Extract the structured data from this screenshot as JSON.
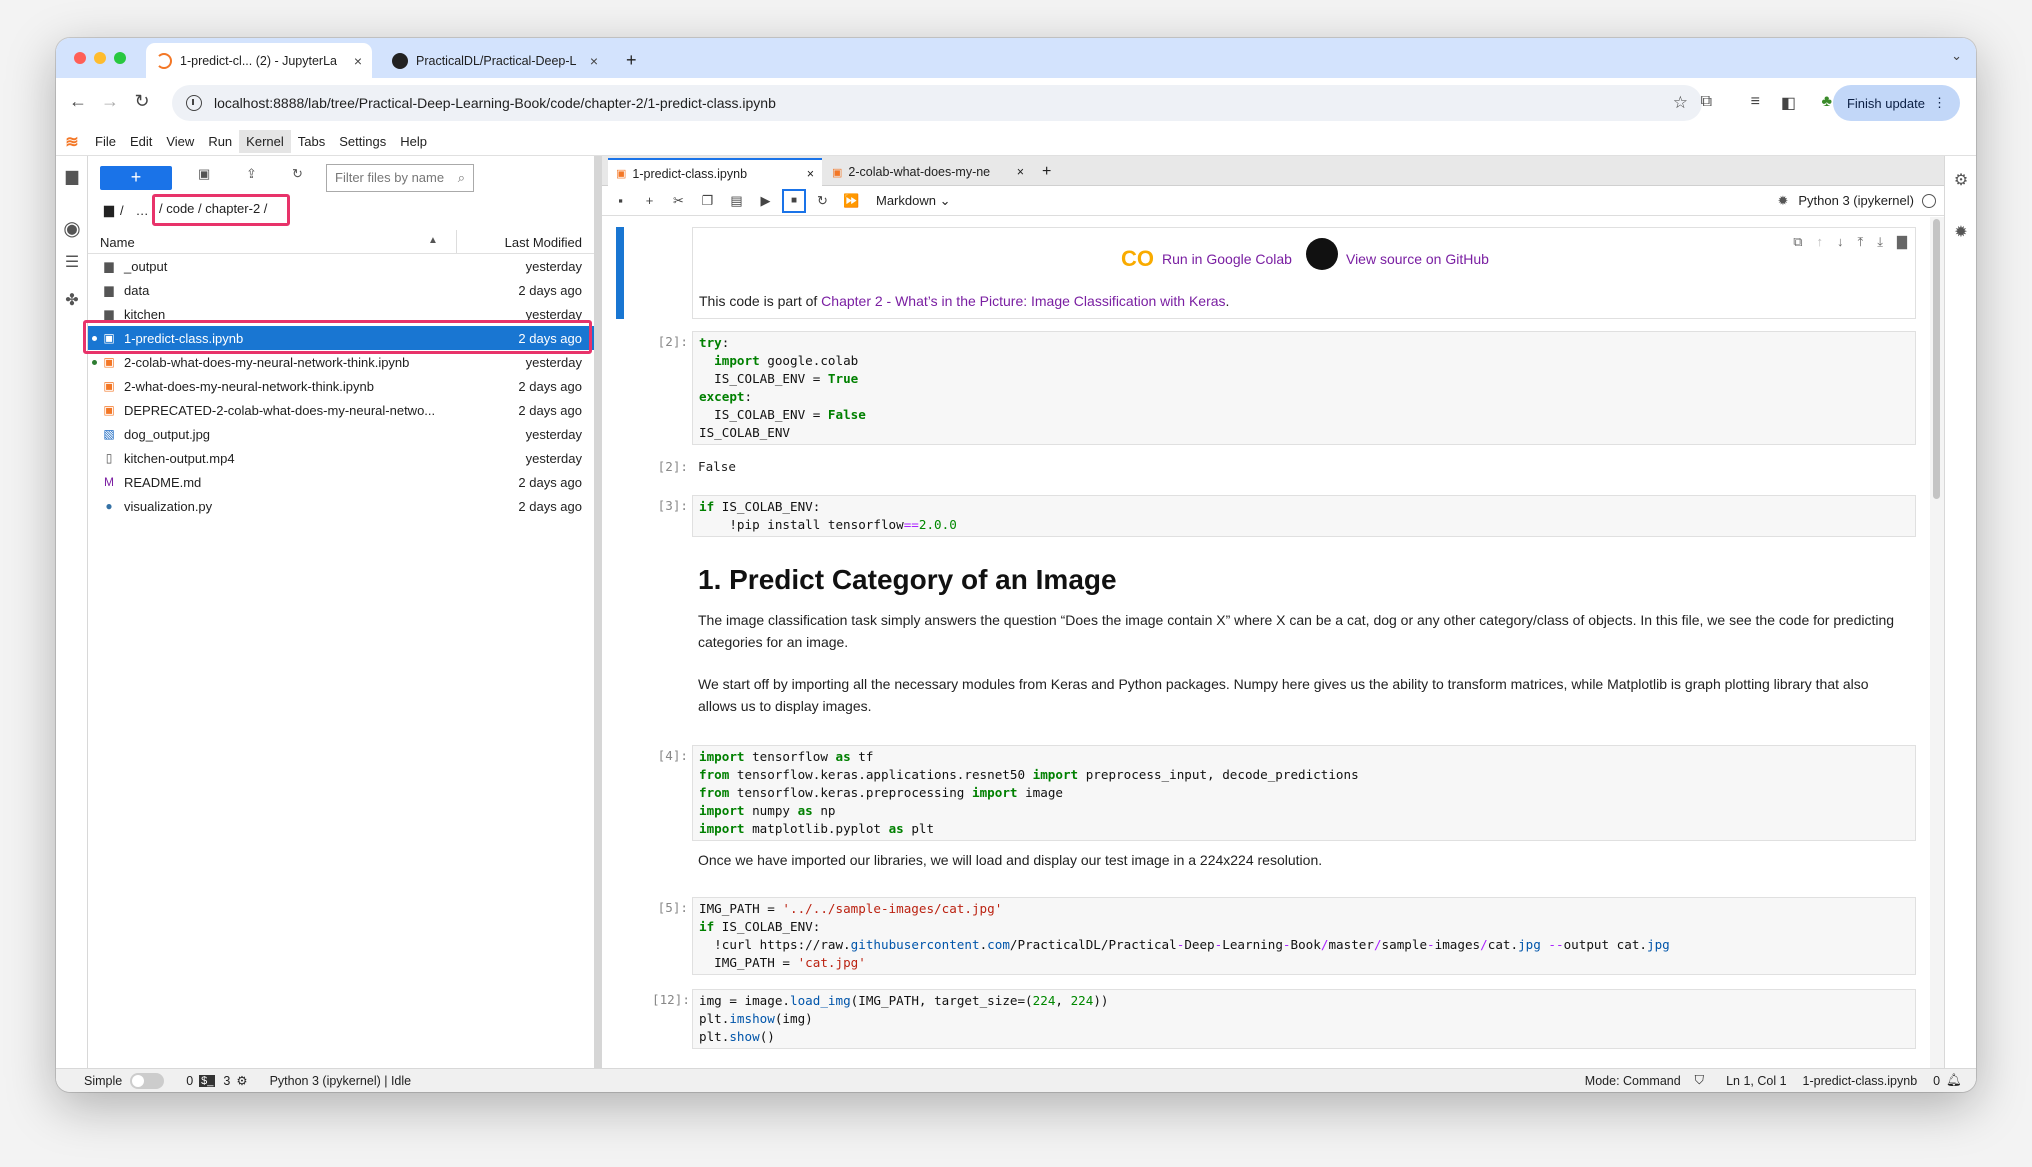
{
  "browser": {
    "tabs": [
      {
        "title": "1-predict-cl... (2) - JupyterLa",
        "close": "×"
      },
      {
        "title": "PracticalDL/Practical-Deep-L",
        "close": "×"
      }
    ],
    "new_tab": "+",
    "url": "localhost:8888/lab/tree/Practical-Deep-Learning-Book/code/chapter-2/1-predict-class.ipynb",
    "finish_update": "Finish update",
    "colors": {
      "close": "#ff5f57",
      "min": "#febc2e",
      "max": "#28c840"
    }
  },
  "menu": {
    "logo": "≋",
    "items": [
      "File",
      "Edit",
      "View",
      "Run",
      "Kernel",
      "Tabs",
      "Settings",
      "Help"
    ],
    "selected": "Kernel"
  },
  "filebrowser": {
    "new": "+",
    "filter_placeholder": "Filter files by name",
    "crumb_root": "/",
    "crumb_ellipsis": "…",
    "crumb_path": "/ code / chapter-2 /",
    "col_name": "Name",
    "col_modified": "Last Modified",
    "files": [
      {
        "name": "_output",
        "modified": "yesterday",
        "icon": "folder-icon"
      },
      {
        "name": "data",
        "modified": "2 days ago",
        "icon": "folder-icon"
      },
      {
        "name": "kitchen",
        "modified": "yesterday",
        "icon": "folder-icon"
      },
      {
        "name": "1-predict-class.ipynb",
        "modified": "2 days ago",
        "icon": "notebook-icon"
      },
      {
        "name": "2-colab-what-does-my-neural-network-think.ipynb",
        "modified": "yesterday",
        "icon": "notebook-icon"
      },
      {
        "name": "2-what-does-my-neural-network-think.ipynb",
        "modified": "2 days ago",
        "icon": "notebook-icon"
      },
      {
        "name": "DEPRECATED-2-colab-what-does-my-neural-netwo...",
        "modified": "2 days ago",
        "icon": "notebook-icon"
      },
      {
        "name": "dog_output.jpg",
        "modified": "yesterday",
        "icon": "image-icon"
      },
      {
        "name": "kitchen-output.mp4",
        "modified": "yesterday",
        "icon": "file-icon"
      },
      {
        "name": "README.md",
        "modified": "2 days ago",
        "icon": "markdown-icon"
      },
      {
        "name": "visualization.py",
        "modified": "2 days ago",
        "icon": "python-icon"
      }
    ]
  },
  "notebook": {
    "tabs": [
      "1-predict-class.ipynb",
      "2-colab-what-does-my-ne"
    ],
    "cell_type": "Markdown",
    "kernel": "Python 3 (ipykernel)",
    "colab_link": "Run in Google Colab",
    "github_link": "View source on GitHub",
    "intro_prefix": "This code is part of ",
    "intro_link": "Chapter 2 - What’s in the Picture: Image Classification with Keras",
    "intro_suffix": ".",
    "prompts": {
      "p2": "[2]:",
      "p3": "[3]:",
      "p4": "[4]:",
      "p5": "[5]:",
      "p12": "[12]:"
    },
    "out2": "False",
    "heading": "1. Predict Category of an Image",
    "para1": "The image classification task simply answers the question “Does the image contain X” where X can be a cat, dog or any other category/class of objects. In this file, we see the code for predicting categories for an image.",
    "para2": "We start off by importing all the necessary modules from Keras and Python packages. Numpy here gives us the ability to transform matrices, while Matplotlib is graph plotting library that also allows us to display images.",
    "para3": "Once we have imported our libraries, we will load and display our test image in a 224x224 resolution."
  },
  "status": {
    "mode_label": "Simple",
    "terminals": "0",
    "kernels": "3",
    "kernel_state": "Python 3 (ipykernel) | Idle",
    "mode": "Mode: Command",
    "position": "Ln 1, Col 1",
    "file": "1-predict-class.ipynb",
    "notifications": "0"
  }
}
